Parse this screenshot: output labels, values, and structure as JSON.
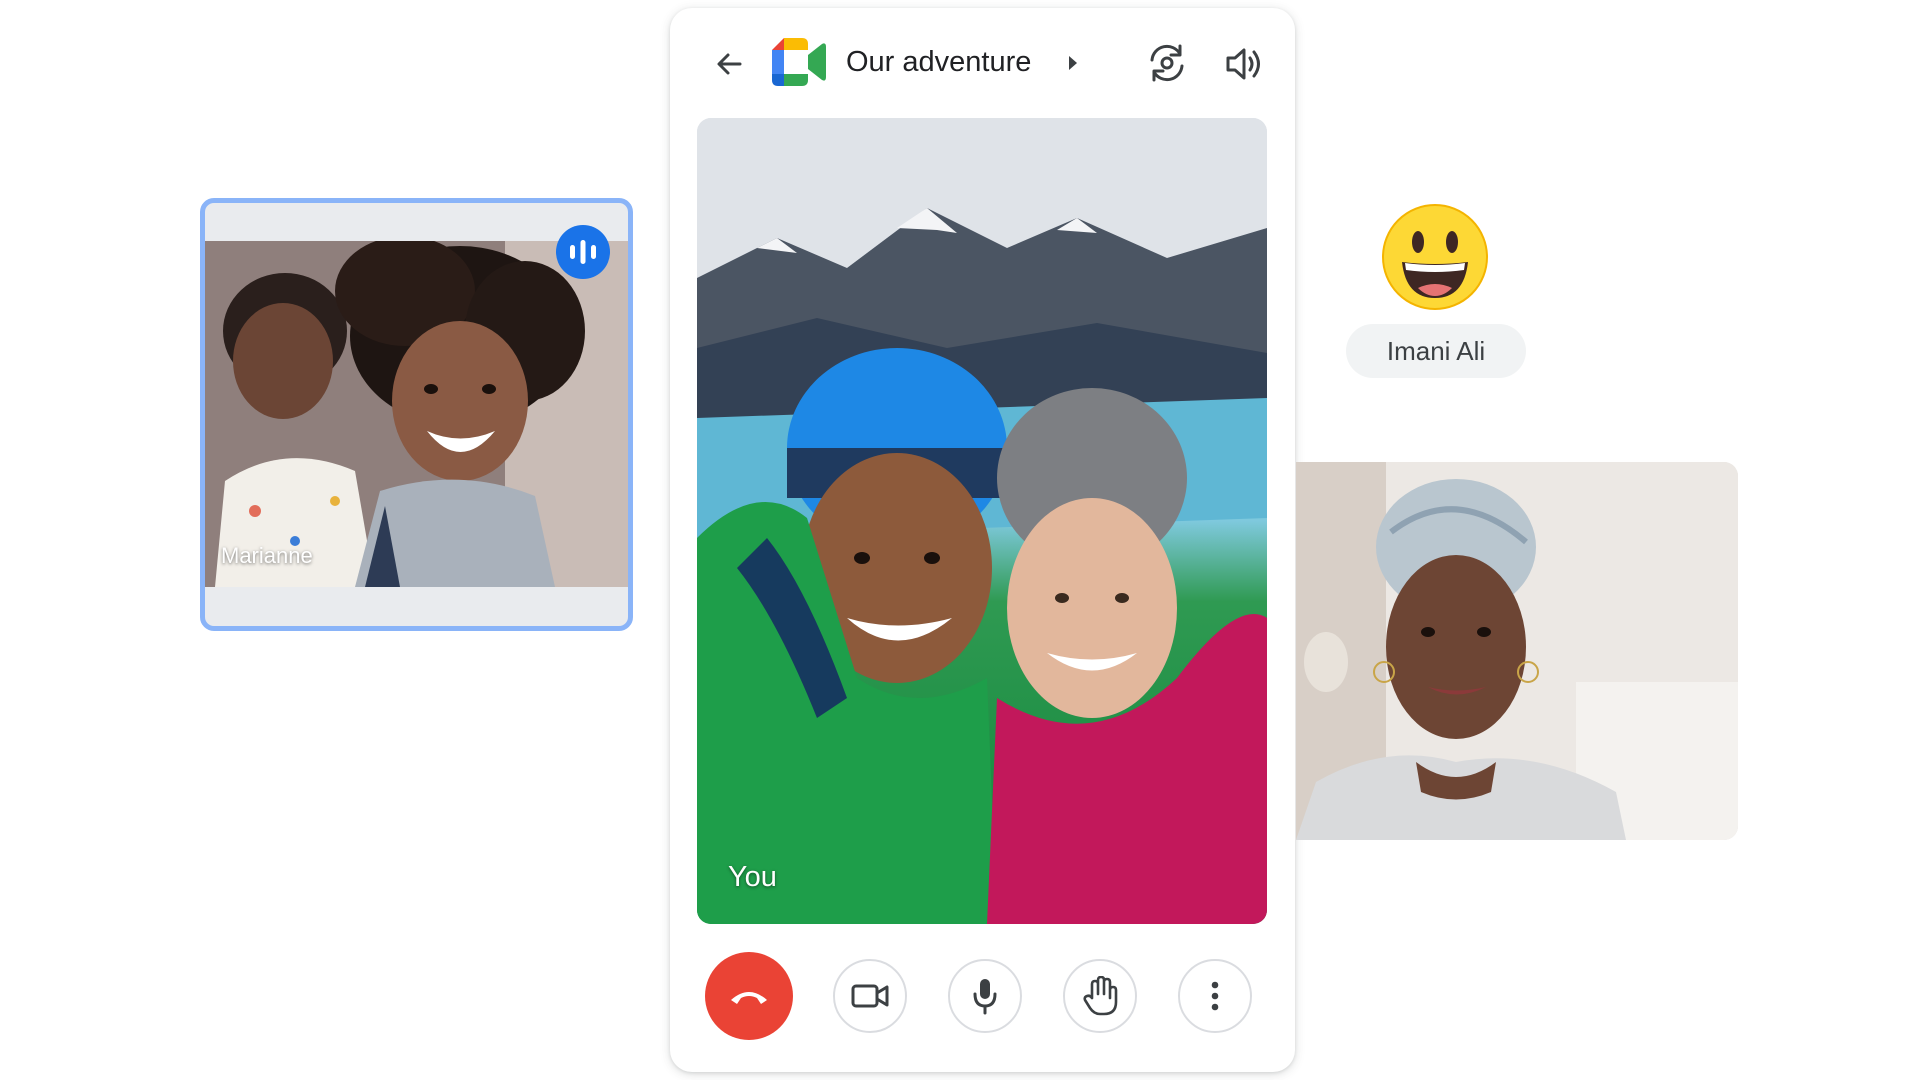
{
  "meeting": {
    "title": "Our adventure"
  },
  "participants": {
    "left": {
      "name": "Marianne",
      "speaking": true
    },
    "main": {
      "name": "You"
    },
    "right": {
      "name": "Imani Ali",
      "reaction": "grinning-face"
    }
  },
  "colors": {
    "accent_blue": "#1a73e8",
    "highlight_border": "#8ab4f8",
    "end_call_red": "#ea4335",
    "chip_bg": "#f1f3f4",
    "text_primary": "#202124"
  },
  "icons": {
    "back": "arrow-left-icon",
    "logo": "google-meet-logo",
    "caret": "caret-right-icon",
    "switch_camera": "switch-camera-icon",
    "speaker": "speaker-icon",
    "speaking": "audio-bars-icon",
    "end_call": "phone-hangup-icon",
    "camera": "video-camera-icon",
    "mic": "microphone-icon",
    "raise_hand": "hand-icon",
    "more": "more-vert-icon"
  }
}
